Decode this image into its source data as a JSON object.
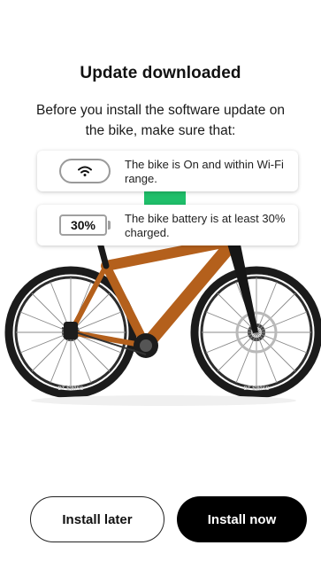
{
  "dialog": {
    "title": "Update downloaded",
    "subtitle": "Before you install the software update on the bike, make sure that:"
  },
  "checklist": [
    {
      "icon": "wifi-icon",
      "text": "The bike is On and within Wi-Fi range."
    },
    {
      "icon": "battery-icon",
      "badge": "30%",
      "text": "The bike battery is at least 30% charged."
    }
  ],
  "bike_image": {
    "brand_text": "DT SWISS"
  },
  "actions": {
    "later_label": "Install later",
    "now_label": "Install now"
  },
  "colors": {
    "bike_frame": "#b4601c",
    "accent_green": "#1fbf6a",
    "primary_button": "#000000"
  }
}
